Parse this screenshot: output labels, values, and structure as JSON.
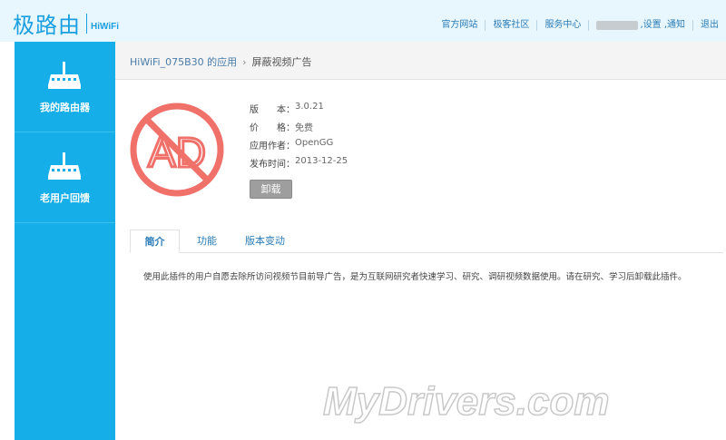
{
  "header": {
    "logo_cn": "极路由",
    "logo_en": "HiWiFi",
    "links": [
      "官方网站",
      "极客社区",
      "服务中心"
    ],
    "user_links": [
      ",设置",
      ",通知"
    ],
    "logout": "退出"
  },
  "sidebar": {
    "items": [
      {
        "label": "我的路由器",
        "icon": "router-icon"
      },
      {
        "label": "老用户回馈",
        "icon": "router-icon"
      }
    ]
  },
  "breadcrumb": {
    "parent": "HiWiFi_075B30 的应用",
    "separator": "›",
    "current": "屏蔽视频广告"
  },
  "app": {
    "icon": "no-ad-icon",
    "icon_text": "AD",
    "icon_color": "#f0706a",
    "details": [
      {
        "key": "版　　本：",
        "value": "3.0.21"
      },
      {
        "key": "价　　格：",
        "value": "免费"
      },
      {
        "key": "应用作者：",
        "value": "OpenGG"
      },
      {
        "key": "发布时间：",
        "value": "2013-12-25"
      }
    ],
    "uninstall_label": "卸载"
  },
  "tabs": {
    "items": [
      "简介",
      "功能",
      "版本变动"
    ],
    "active": "简介"
  },
  "description": "使用此插件的用户自愿去除所访问视频节目前导广告，是为互联网研究者快速学习、研究、调研视频数据使用。请在研究、学习后卸载此插件。",
  "watermark": "MyDrivers.com",
  "colors": {
    "brand": "#1a9fe0",
    "sidebar": "#16aee8",
    "topbar": "#e8f6fd"
  }
}
